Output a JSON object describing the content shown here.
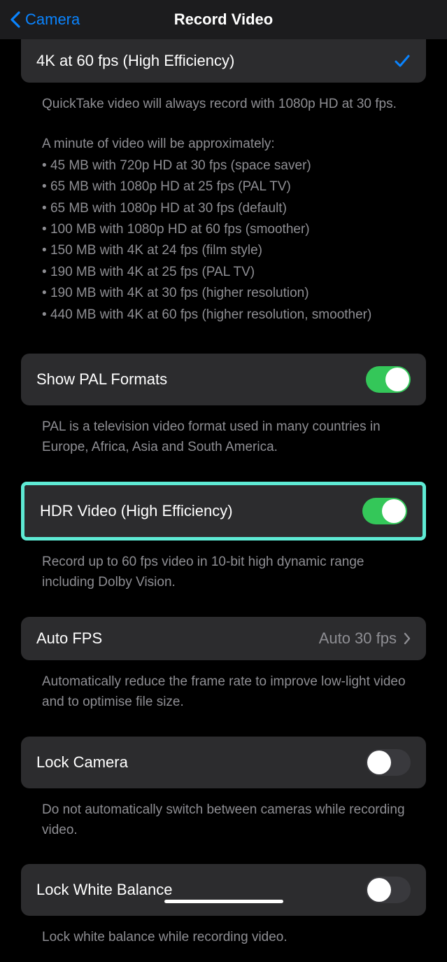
{
  "nav": {
    "back_label": "Camera",
    "title": "Record Video"
  },
  "selected_option": {
    "label": "4K at 60 fps (High Efficiency)"
  },
  "quicktake_note": "QuickTake video will always record with 1080p HD at 30 fps.",
  "size_intro": "A minute of video will be approximately:",
  "sizes": [
    "45 MB with 720p HD at 30 fps (space saver)",
    "65 MB with 1080p HD at 25 fps (PAL TV)",
    "65 MB with 1080p HD at 30 fps (default)",
    "100 MB with 1080p HD at 60 fps (smoother)",
    "150 MB with 4K at 24 fps (film style)",
    "190 MB with 4K at 25 fps (PAL TV)",
    "190 MB with 4K at 30 fps (higher resolution)",
    "440 MB with 4K at 60 fps (higher resolution, smoother)"
  ],
  "pal": {
    "label": "Show PAL Formats",
    "on": true,
    "footer": "PAL is a television video format used in many countries in Europe, Africa, Asia and South America."
  },
  "hdr": {
    "label": "HDR Video (High Efficiency)",
    "on": true,
    "footer": "Record up to 60 fps video in 10-bit high dynamic range including Dolby Vision."
  },
  "autofps": {
    "label": "Auto FPS",
    "value": "Auto 30 fps",
    "footer": "Automatically reduce the frame rate to improve low-light video and to optimise file size."
  },
  "lockcam": {
    "label": "Lock Camera",
    "on": false,
    "footer": "Do not automatically switch between cameras while recording video."
  },
  "lockwb": {
    "label": "Lock White Balance",
    "on": false,
    "footer": "Lock white balance while recording video."
  }
}
